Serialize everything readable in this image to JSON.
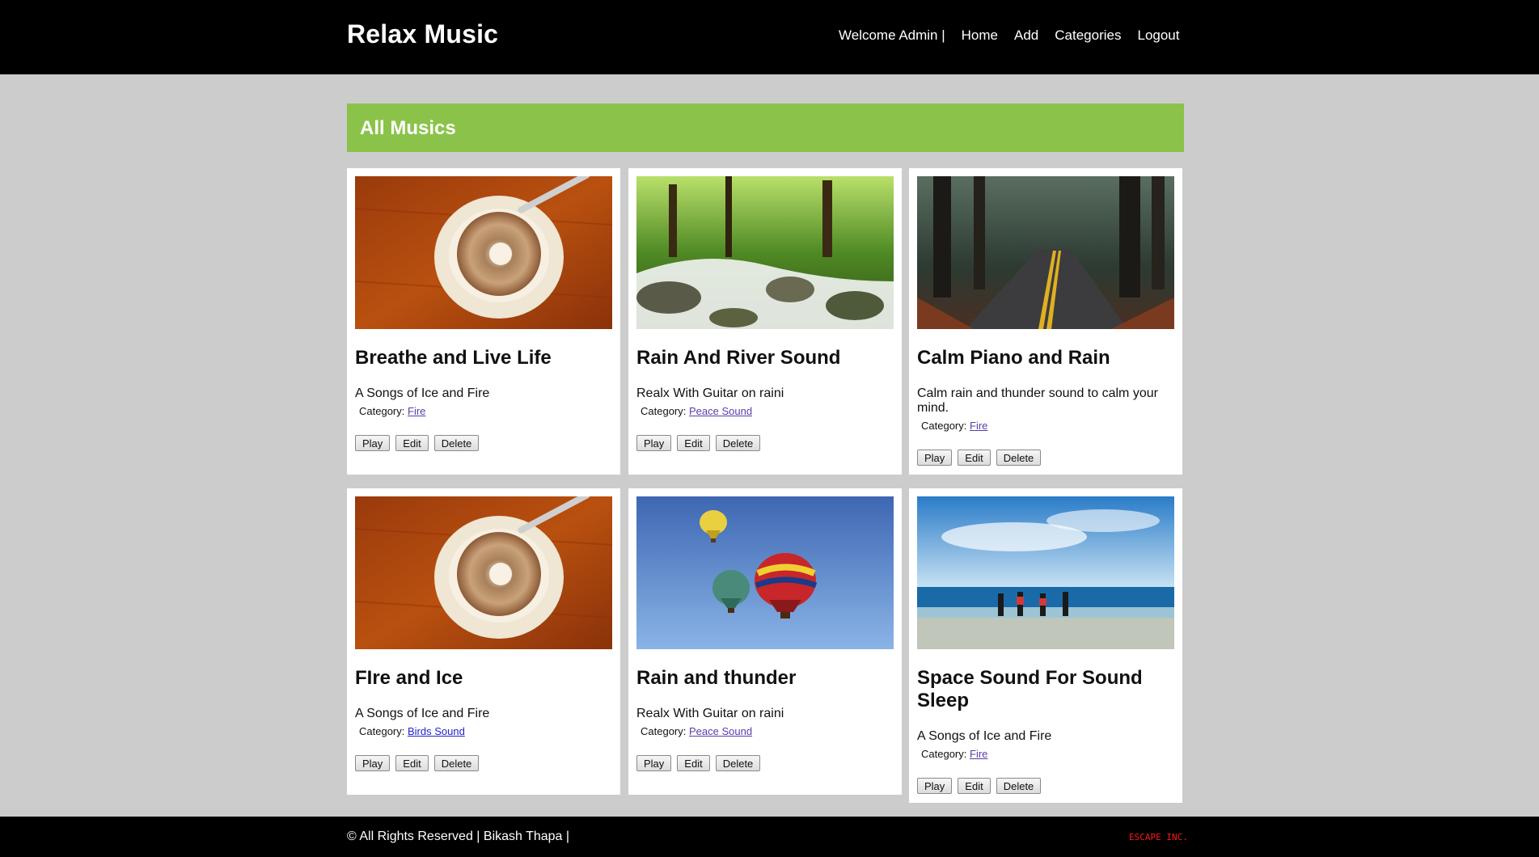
{
  "header": {
    "brand": "Relax Music",
    "welcome": "Welcome Admin |",
    "nav": [
      "Home",
      "Add",
      "Categories",
      "Logout"
    ]
  },
  "banner": {
    "title": "All Musics"
  },
  "labels": {
    "category_prefix": "Category:"
  },
  "buttons": {
    "play": "Play",
    "edit": "Edit",
    "delete": "Delete"
  },
  "cards": [
    {
      "title": "Breathe and Live Life",
      "desc": "A Songs of Ice and Fire",
      "category": "Fire",
      "image": "coffee-cup-image"
    },
    {
      "title": "Rain And River Sound",
      "desc": "Realx With Guitar on raini",
      "category": "Peace Sound",
      "image": "forest-river-image"
    },
    {
      "title": "Calm Piano and Rain",
      "desc": "Calm rain and thunder sound to calm your mind.",
      "category": "Fire",
      "image": "forest-road-image"
    },
    {
      "title": "FIre and Ice",
      "desc": "A Songs of Ice and Fire",
      "category": "Birds Sound",
      "image": "coffee-cup-image"
    },
    {
      "title": "Rain and thunder",
      "desc": "Realx With Guitar on raini",
      "category": "Peace Sound",
      "image": "hot-air-balloons-image"
    },
    {
      "title": "Space Sound For Sound Sleep",
      "desc": "A Songs of Ice and Fire",
      "category": "Fire",
      "image": "beach-runners-image"
    }
  ],
  "footer": {
    "copyright": "© All Rights Reserved | Bikash Thapa |",
    "credit": "ESCAPE INC."
  }
}
